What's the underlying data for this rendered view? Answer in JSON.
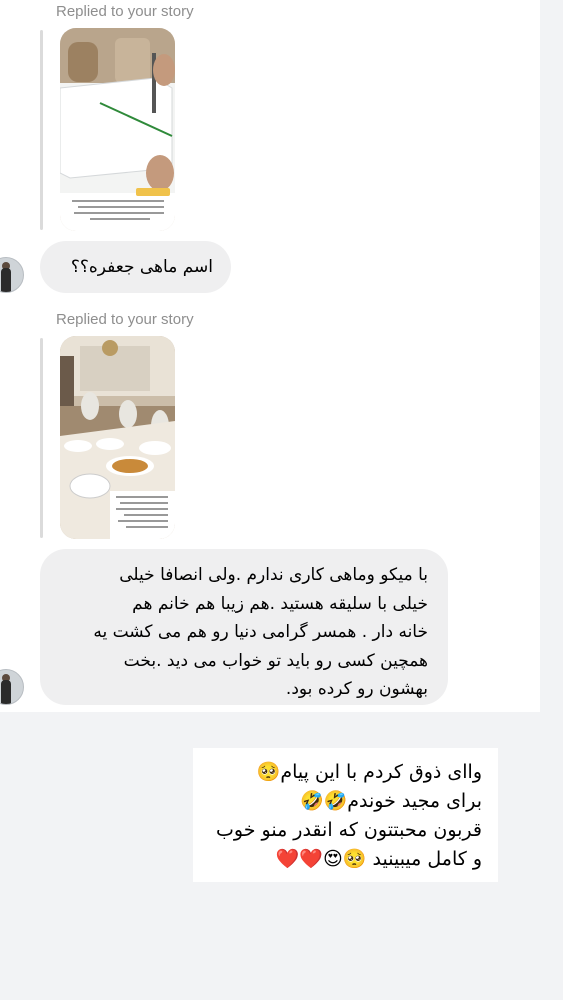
{
  "thread": {
    "first_story_reply": {
      "reply_label": "Replied to your story",
      "message": "اسم ماهی جعفره؟؟"
    },
    "second_story_reply": {
      "reply_label": "Replied to your story",
      "message": "با میکو وماهی کاری ندارم .ولی انصافا خیلی\nخیلی با سلیقه هستید .هم زیبا هم خانم هم\nخانه دار . همسر گرامی دنیا رو هم می کشت یه\nهمچین کسی رو باید تو خواب می دید .بخت\nبهشون رو کرده بود."
    },
    "own_message": "واای ذوق کردم با این پیام🥺\nبرای مجید خوندم🤣🤣\nقربون محبتتون که انقدر منو خوب\nو کامل میبینید 🥺😍❤️❤️"
  }
}
